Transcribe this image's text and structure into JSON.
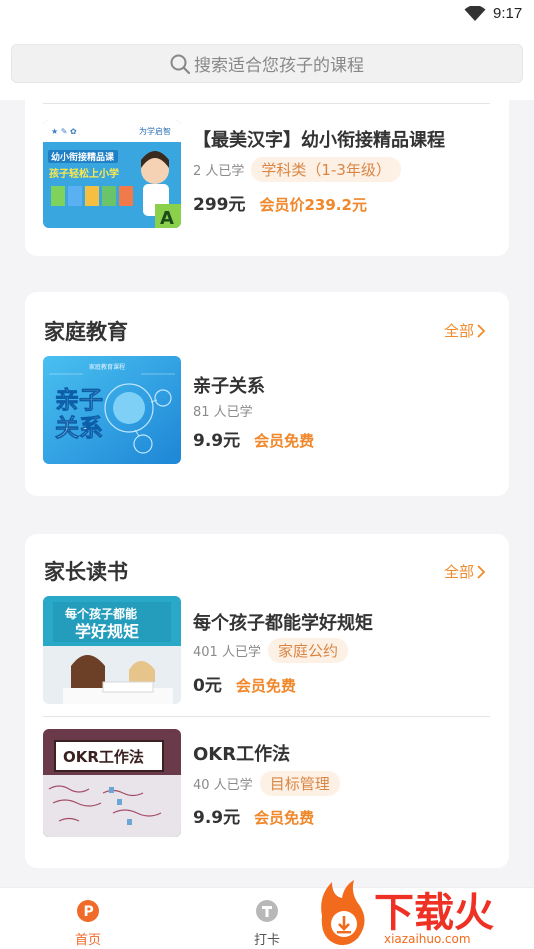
{
  "status_bar": {
    "time": "9:17"
  },
  "search": {
    "placeholder": "搜索适合您孩子的课程"
  },
  "card1": {
    "course": {
      "title": "【最美汉字】幼小衔接精品课程",
      "learners": "2 人已学",
      "tag": "学科类（1-3年级）",
      "price": "299元",
      "member_price": "会员价239.2元",
      "thumb_text": {
        "line1": "幼小衔接精品课",
        "line2": "孩子轻松上小学",
        "letter": "A",
        "brand": "为学启智"
      }
    }
  },
  "family_education": {
    "title": "家庭教育",
    "all_label": "全部",
    "course": {
      "title": "亲子关系",
      "learners": "81 人已学",
      "price": "9.9元",
      "member_price": "会员免费",
      "thumb_text": {
        "header": "家庭教育课程",
        "line1": "亲子",
        "line2": "关系"
      }
    }
  },
  "parent_reading": {
    "title": "家长读书",
    "all_label": "全部",
    "courses": [
      {
        "title": "每个孩子都能学好规矩",
        "learners": "401 人已学",
        "tag": "家庭公约",
        "price": "0元",
        "member_price": "会员免费",
        "thumb_text": {
          "line1": "每个孩子都能",
          "line2": "学好规矩"
        }
      },
      {
        "title": "OKR工作法",
        "learners": "40 人已学",
        "tag": "目标管理",
        "price": "9.9元",
        "member_price": "会员免费",
        "thumb_text": {
          "line1": "OKR工作法"
        }
      }
    ]
  },
  "tabbar": {
    "tabs": [
      {
        "label": "首页",
        "active": true
      },
      {
        "label": "打卡",
        "active": false
      }
    ]
  },
  "watermark": {
    "brand": "下载火",
    "url": "xiazaihuo.com"
  },
  "colors": {
    "accent": "#f0872a",
    "active_tab": "#f06a2a",
    "tag_bg": "#fdf1e6"
  }
}
